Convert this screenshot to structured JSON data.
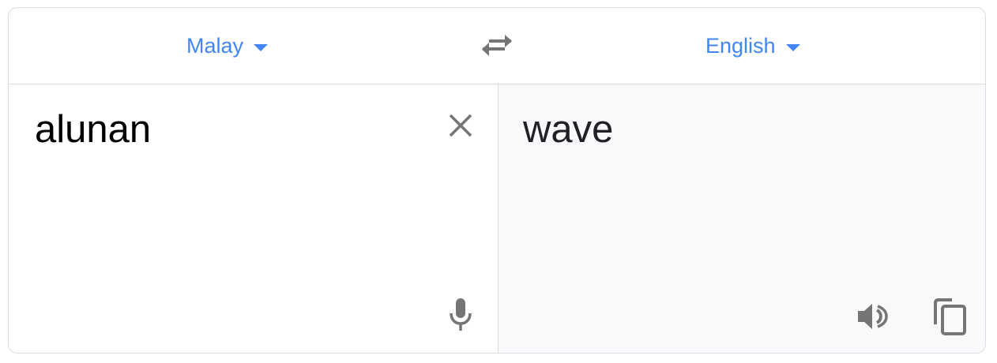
{
  "source_language": {
    "label": "Malay",
    "icon": "caret-down-icon"
  },
  "target_language": {
    "label": "English",
    "icon": "caret-down-icon"
  },
  "swap": {
    "icon": "swap-arrows-icon"
  },
  "source": {
    "text": "alunan",
    "clear_icon": "close-icon",
    "mic_icon": "microphone-icon"
  },
  "translation": {
    "text": "wave",
    "listen_icon": "speaker-icon",
    "copy_icon": "copy-icon"
  },
  "colors": {
    "accent": "#4285f4",
    "icon": "#757575",
    "border": "#dadce0",
    "result_bg": "#f8f9fa"
  }
}
